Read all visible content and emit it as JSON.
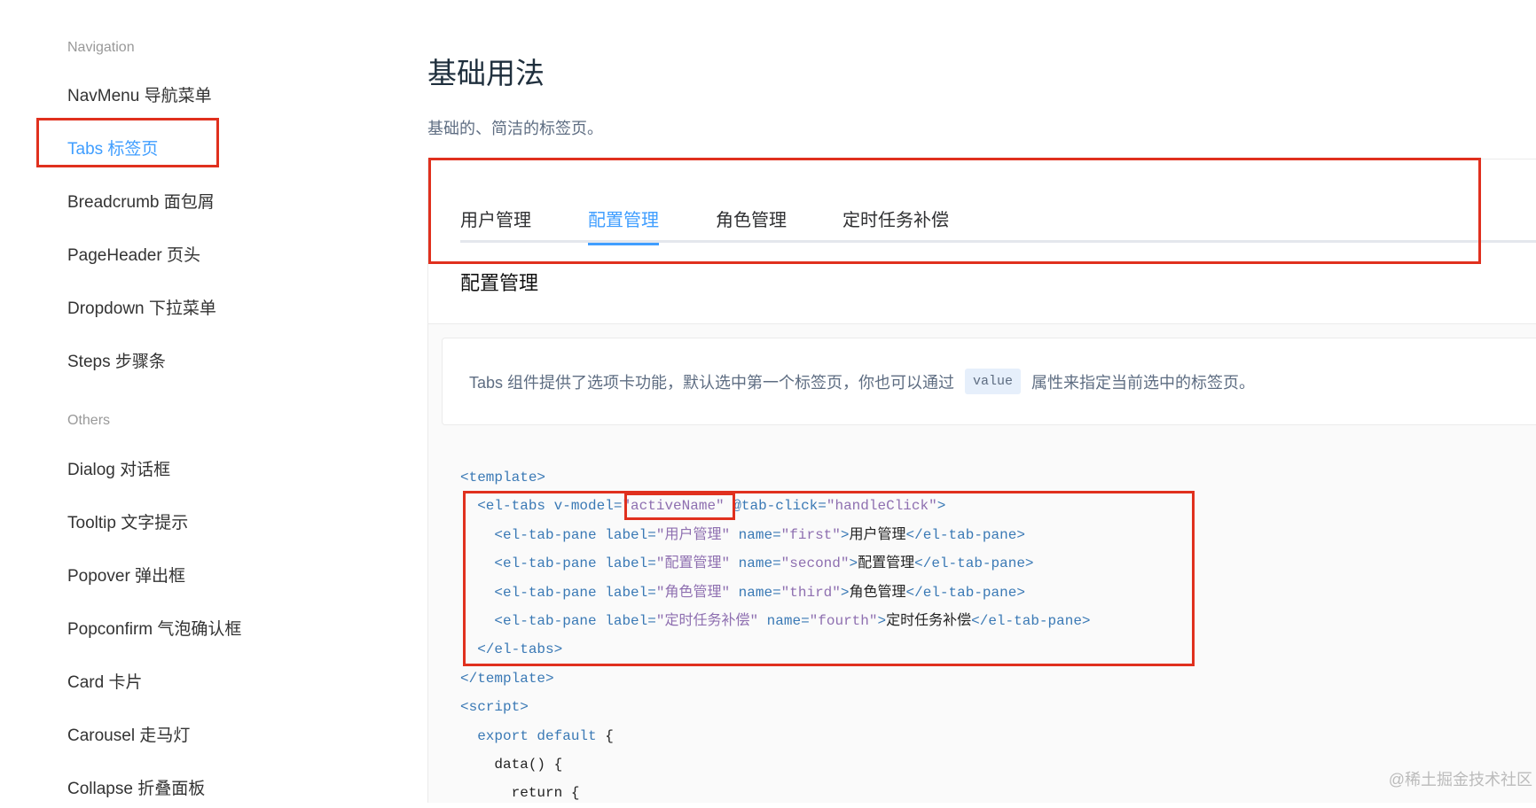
{
  "sidebar": {
    "groups": [
      {
        "title": "Navigation",
        "items": [
          "NavMenu 导航菜单",
          "Tabs 标签页",
          "Breadcrumb 面包屑",
          "PageHeader 页头",
          "Dropdown 下拉菜单",
          "Steps 步骤条"
        ]
      },
      {
        "title": "Others",
        "items": [
          "Dialog 对话框",
          "Tooltip 文字提示",
          "Popover 弹出框",
          "Popconfirm 气泡确认框",
          "Card 卡片",
          "Carousel 走马灯",
          "Collapse 折叠面板"
        ]
      }
    ],
    "active": "Tabs 标签页"
  },
  "main": {
    "title": "基础用法",
    "subtitle": "基础的、简洁的标签页。",
    "demo": {
      "tabs": [
        "用户管理",
        "配置管理",
        "角色管理",
        "定时任务补偿"
      ],
      "active_tab": 1,
      "pane_content": "配置管理"
    },
    "description": {
      "before": "Tabs 组件提供了选项卡功能，默认选中第一个标签页，你也可以通过",
      "code": "value",
      "after": "属性来指定当前选中的标签页。"
    },
    "code_lines": [
      [
        [
          "tag",
          "<template>"
        ]
      ],
      [
        [
          "tag",
          "  <el-tabs "
        ],
        [
          "attr",
          "v-model="
        ],
        [
          "str",
          "\"activeName\""
        ],
        [
          "attr",
          " @tab-click="
        ],
        [
          "str",
          "\"handleClick\""
        ],
        [
          "tag",
          ">"
        ]
      ],
      [
        [
          "tag",
          "    <el-tab-pane "
        ],
        [
          "attr",
          "label="
        ],
        [
          "str",
          "\"用户管理\""
        ],
        [
          "attr",
          " name="
        ],
        [
          "str",
          "\"first\""
        ],
        [
          "tag",
          ">"
        ],
        [
          "txt",
          "用户管理"
        ],
        [
          "tag",
          "</el-tab-pane>"
        ]
      ],
      [
        [
          "tag",
          "    <el-tab-pane "
        ],
        [
          "attr",
          "label="
        ],
        [
          "str",
          "\"配置管理\""
        ],
        [
          "attr",
          " name="
        ],
        [
          "str",
          "\"second\""
        ],
        [
          "tag",
          ">"
        ],
        [
          "txt",
          "配置管理"
        ],
        [
          "tag",
          "</el-tab-pane>"
        ]
      ],
      [
        [
          "tag",
          "    <el-tab-pane "
        ],
        [
          "attr",
          "label="
        ],
        [
          "str",
          "\"角色管理\""
        ],
        [
          "attr",
          " name="
        ],
        [
          "str",
          "\"third\""
        ],
        [
          "tag",
          ">"
        ],
        [
          "txt",
          "角色管理"
        ],
        [
          "tag",
          "</el-tab-pane>"
        ]
      ],
      [
        [
          "tag",
          "    <el-tab-pane "
        ],
        [
          "attr",
          "label="
        ],
        [
          "str",
          "\"定时任务补偿\""
        ],
        [
          "attr",
          " name="
        ],
        [
          "str",
          "\"fourth\""
        ],
        [
          "tag",
          ">"
        ],
        [
          "txt",
          "定时任务补偿"
        ],
        [
          "tag",
          "</el-tab-pane>"
        ]
      ],
      [
        [
          "tag",
          "  </el-tabs>"
        ]
      ],
      [
        [
          "tag",
          "</template>"
        ]
      ],
      [
        [
          "tag",
          "<script>"
        ]
      ],
      [
        [
          "kw",
          "  export default "
        ],
        [
          "plain",
          "{"
        ]
      ],
      [
        [
          "plain",
          "    data() {"
        ]
      ],
      [
        [
          "plain",
          "      return {"
        ]
      ]
    ]
  },
  "watermark": "@稀土掘金技术社区",
  "colors": {
    "accent": "#409eff",
    "annotation": "#e0301e"
  }
}
